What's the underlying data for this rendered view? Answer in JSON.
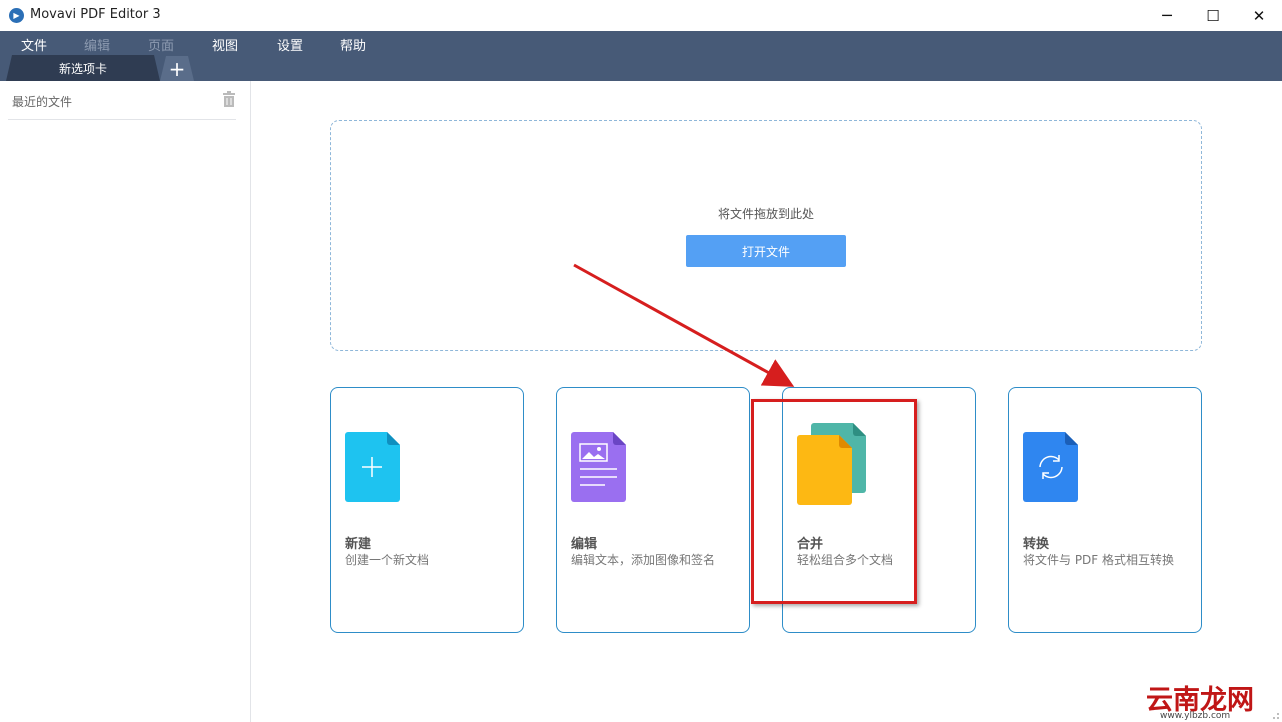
{
  "window": {
    "title": "Movavi PDF Editor 3",
    "minimize": "─",
    "maximize": "☐",
    "close": "✕"
  },
  "menu": {
    "items": [
      {
        "label": "文件",
        "enabled": true
      },
      {
        "label": "编辑",
        "enabled": false
      },
      {
        "label": "页面",
        "enabled": false
      },
      {
        "label": "视图",
        "enabled": true
      },
      {
        "label": "设置",
        "enabled": true
      },
      {
        "label": "帮助",
        "enabled": true
      }
    ]
  },
  "tabs": {
    "active_label": "新选项卡",
    "add_label": "+"
  },
  "sidebar": {
    "title": "最近的文件"
  },
  "dropzone": {
    "text": "将文件拖放到此处",
    "open_button": "打开文件"
  },
  "cards": [
    {
      "id": "new",
      "title": "新建",
      "desc": "创建一个新文档",
      "icon": "new-document-icon",
      "color": "#1ec3f0"
    },
    {
      "id": "edit",
      "title": "编辑",
      "desc": "编辑文本，添加图像和签名",
      "icon": "edit-document-icon",
      "color": "#9a6ff0"
    },
    {
      "id": "merge",
      "title": "合并",
      "desc": "轻松组合多个文档",
      "icon": "merge-documents-icon",
      "color": "#fdb813"
    },
    {
      "id": "convert",
      "title": "转换",
      "desc": "将文件与 PDF 格式相互转换",
      "icon": "convert-document-icon",
      "color": "#2f86f0"
    }
  ],
  "watermark": {
    "text": "云南龙网",
    "sub": "www.ylbzb.com"
  },
  "colors": {
    "menubar": "#475a77",
    "accent": "#54a0f4",
    "card_border": "#2e8dc8",
    "annotation_red": "#d61e1e"
  }
}
